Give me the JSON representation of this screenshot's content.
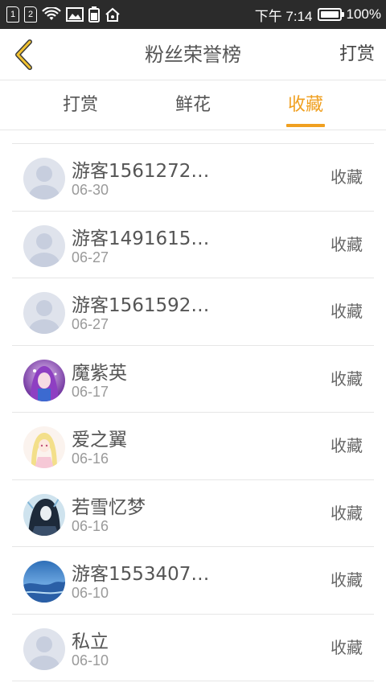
{
  "status_bar": {
    "sim1": "1",
    "sim2": "2",
    "time": "下午 7:14",
    "battery": "100%",
    "battery_level": 1.0,
    "icons": [
      "sim-1-icon",
      "sim-2-icon",
      "wifi-icon",
      "gallery-icon",
      "battery-saver-icon",
      "home-icon"
    ]
  },
  "header": {
    "title": "粉丝荣誉榜",
    "reward_label": "打赏",
    "back_icon": "chevron-left-icon"
  },
  "tabs": [
    {
      "label": "打赏",
      "active": false
    },
    {
      "label": "鲜花",
      "active": false
    },
    {
      "label": "收藏",
      "active": true
    }
  ],
  "colors": {
    "accent": "#f0a020",
    "text": "#555555",
    "muted": "#9a9a9a",
    "divider": "#e6e6e6",
    "status_bar": "#2b2b2b"
  },
  "list": [
    {
      "name": "游客1561272…",
      "date": "06-30",
      "action": "收藏",
      "avatar": "default-avatar-icon"
    },
    {
      "name": "游客1491615…",
      "date": "06-27",
      "action": "收藏",
      "avatar": "default-avatar-icon"
    },
    {
      "name": "游客1561592…",
      "date": "06-27",
      "action": "收藏",
      "avatar": "default-avatar-icon"
    },
    {
      "name": "魔紫英",
      "date": "06-17",
      "action": "收藏",
      "avatar": "purple-anime-avatar"
    },
    {
      "name": "爱之翼",
      "date": "06-16",
      "action": "收藏",
      "avatar": "blonde-anime-avatar"
    },
    {
      "name": "若雪忆梦",
      "date": "06-16",
      "action": "收藏",
      "avatar": "dark-anime-avatar"
    },
    {
      "name": "游客1553407…",
      "date": "06-10",
      "action": "收藏",
      "avatar": "blue-landscape-avatar"
    },
    {
      "name": "私立",
      "date": "06-10",
      "action": "收藏",
      "avatar": "default-avatar-icon"
    }
  ]
}
